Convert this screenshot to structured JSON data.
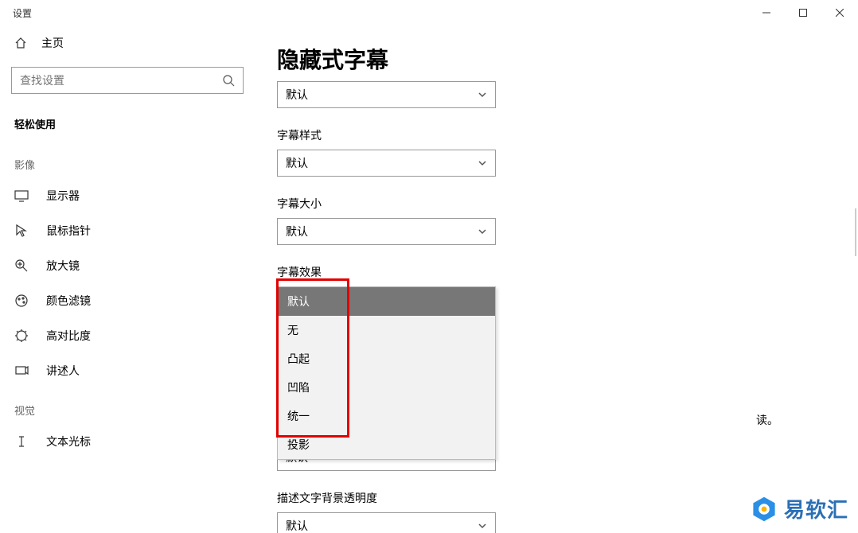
{
  "window": {
    "title": "设置"
  },
  "sidebar": {
    "home": "主页",
    "search_placeholder": "查找设置",
    "group": "轻松使用",
    "section1": "影像",
    "section2": "视觉",
    "items": {
      "display": "显示器",
      "mouse": "鼠标指针",
      "magnifier": "放大镜",
      "colorfilter": "颜色滤镜",
      "contrast": "高对比度",
      "narrator": "讲述人",
      "textcursor": "文本光标"
    }
  },
  "main": {
    "title": "隐藏式字幕",
    "dd1_value": "默认",
    "label_style": "字幕样式",
    "dd_style_value": "默认",
    "label_size": "字幕大小",
    "dd_size_value": "默认",
    "label_effect": "字幕效果",
    "effect_options": {
      "o0": "默认",
      "o1": "无",
      "o2": "凸起",
      "o3": "凹陷",
      "o4": "统一",
      "o5": "投影"
    },
    "trailing": "读。",
    "dd_after1_value": "默认",
    "label_bg_opacity": "描述文字背景透明度",
    "dd_bg_value": "默认"
  },
  "watermark": "易软汇"
}
